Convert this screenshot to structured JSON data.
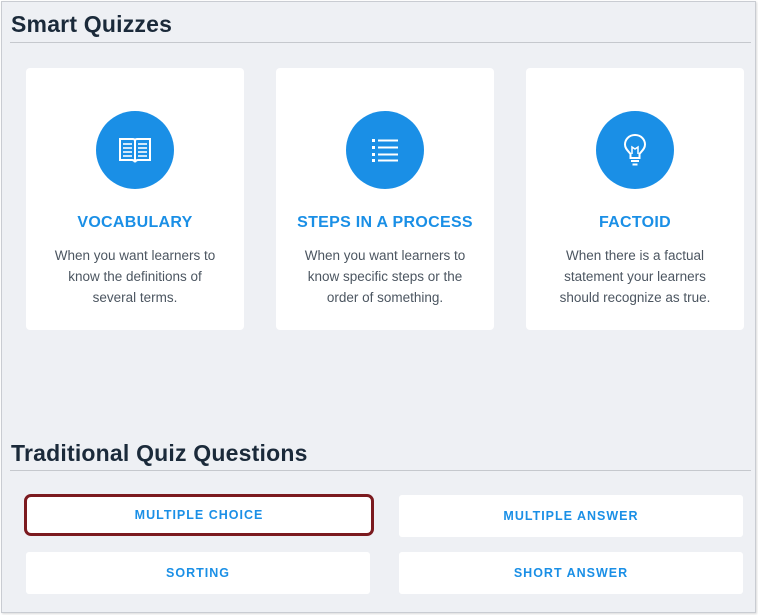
{
  "smart_quizzes": {
    "title": "Smart Quizzes",
    "cards": [
      {
        "title": "VOCABULARY",
        "description": "When you want learners to know the definitions of several terms.",
        "icon": "book-icon"
      },
      {
        "title": "STEPS IN A PROCESS",
        "description": "When you want learners to know specific steps or the order of something.",
        "icon": "list-icon"
      },
      {
        "title": "FACTOID",
        "description": "When there is a factual statement your learners should recognize as true.",
        "icon": "lightbulb-icon"
      }
    ]
  },
  "traditional": {
    "title": "Traditional Quiz Questions",
    "buttons": [
      {
        "label": "MULTIPLE CHOICE",
        "selected": true
      },
      {
        "label": "MULTIPLE ANSWER",
        "selected": false
      },
      {
        "label": "SORTING",
        "selected": false
      },
      {
        "label": "SHORT ANSWER",
        "selected": false
      }
    ]
  },
  "colors": {
    "accent": "#1a8fe6",
    "heading": "#1b2a3a",
    "selected_border": "#7b1a1f",
    "background": "#eef0f4"
  }
}
